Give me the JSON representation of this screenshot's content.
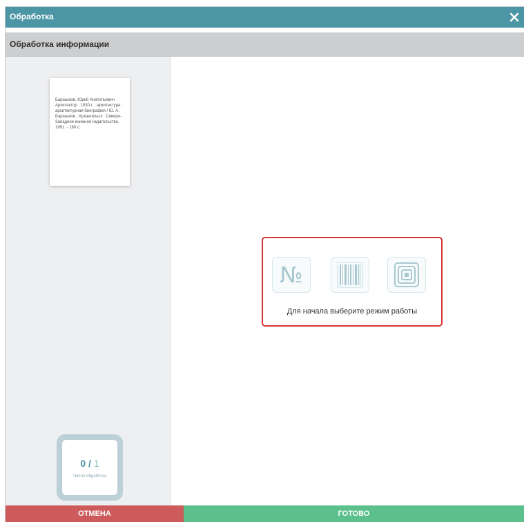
{
  "window": {
    "title": "Обработка",
    "close_icon": "close-icon"
  },
  "subheader": {
    "label": "Обработка информации"
  },
  "card": {
    "text": "Баршыков, Юрий Анатольевич Архитектор : 1930-г. : архитектура : архитектурная биография / Ю. А. Баршыков ; Архангельск : Северо-Западное книжное издательство, 1991. - 160 с."
  },
  "counter": {
    "value": "0",
    "separator": " / ",
    "total": "1",
    "caption": "Число обработок"
  },
  "modes": {
    "number_glyph": "№",
    "number_icon": "number-sign-icon",
    "barcode_icon": "barcode-icon",
    "rfid_icon": "rfid-tag-icon",
    "hint": "Для начала выберите режим работы"
  },
  "footer": {
    "cancel_label": "ОТМЕНА",
    "done_label": "ГОТОВО"
  },
  "colors": {
    "titlebar": "#4b95a4",
    "cancel": "#cd5b5b",
    "done": "#5bc08b",
    "highlight": "#d63535"
  }
}
